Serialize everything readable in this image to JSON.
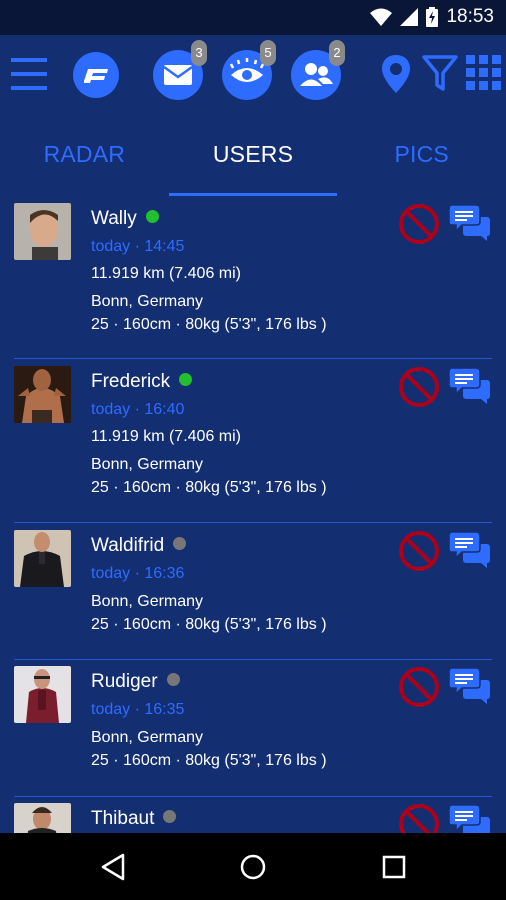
{
  "status": {
    "time": "18:53"
  },
  "header": {
    "badges": {
      "messages": "3",
      "views": "5",
      "friends": "2"
    },
    "icons": [
      "menu-icon",
      "logo-icon",
      "mail-icon",
      "eye-icon",
      "friends-icon",
      "location-icon",
      "filter-icon",
      "grid-icon"
    ]
  },
  "tabs": [
    {
      "label": "RADAR",
      "active": false
    },
    {
      "label": "USERS",
      "active": true
    },
    {
      "label": "PICS",
      "active": false
    }
  ],
  "users": [
    {
      "name": "Wally",
      "online": true,
      "time": "today · 14:45",
      "distance": "11.919 km (7.406 mi)",
      "city": "Bonn, Germany",
      "stats": "25 · 160cm · 80kg (5'3\", 176 lbs )"
    },
    {
      "name": "Frederick",
      "online": true,
      "time": "today · 16:40",
      "distance": "11.919 km (7.406 mi)",
      "city": "Bonn, Germany",
      "stats": "25 · 160cm · 80kg (5'3\", 176 lbs )"
    },
    {
      "name": "Waldifrid",
      "online": false,
      "time": "today · 16:36",
      "city": "Bonn, Germany",
      "stats": "25 · 160cm · 80kg (5'3\", 176 lbs )"
    },
    {
      "name": "Rudiger",
      "online": false,
      "time": "today · 16:35",
      "city": "Bonn, Germany",
      "stats": "25 · 160cm · 80kg (5'3\", 176 lbs )"
    },
    {
      "name": "Thibaut",
      "online": false
    }
  ],
  "colors": {
    "accent": "#2e6bff",
    "online": "#22c02c",
    "offline": "#777777",
    "block": "#b00019",
    "panel": "#142e72"
  }
}
